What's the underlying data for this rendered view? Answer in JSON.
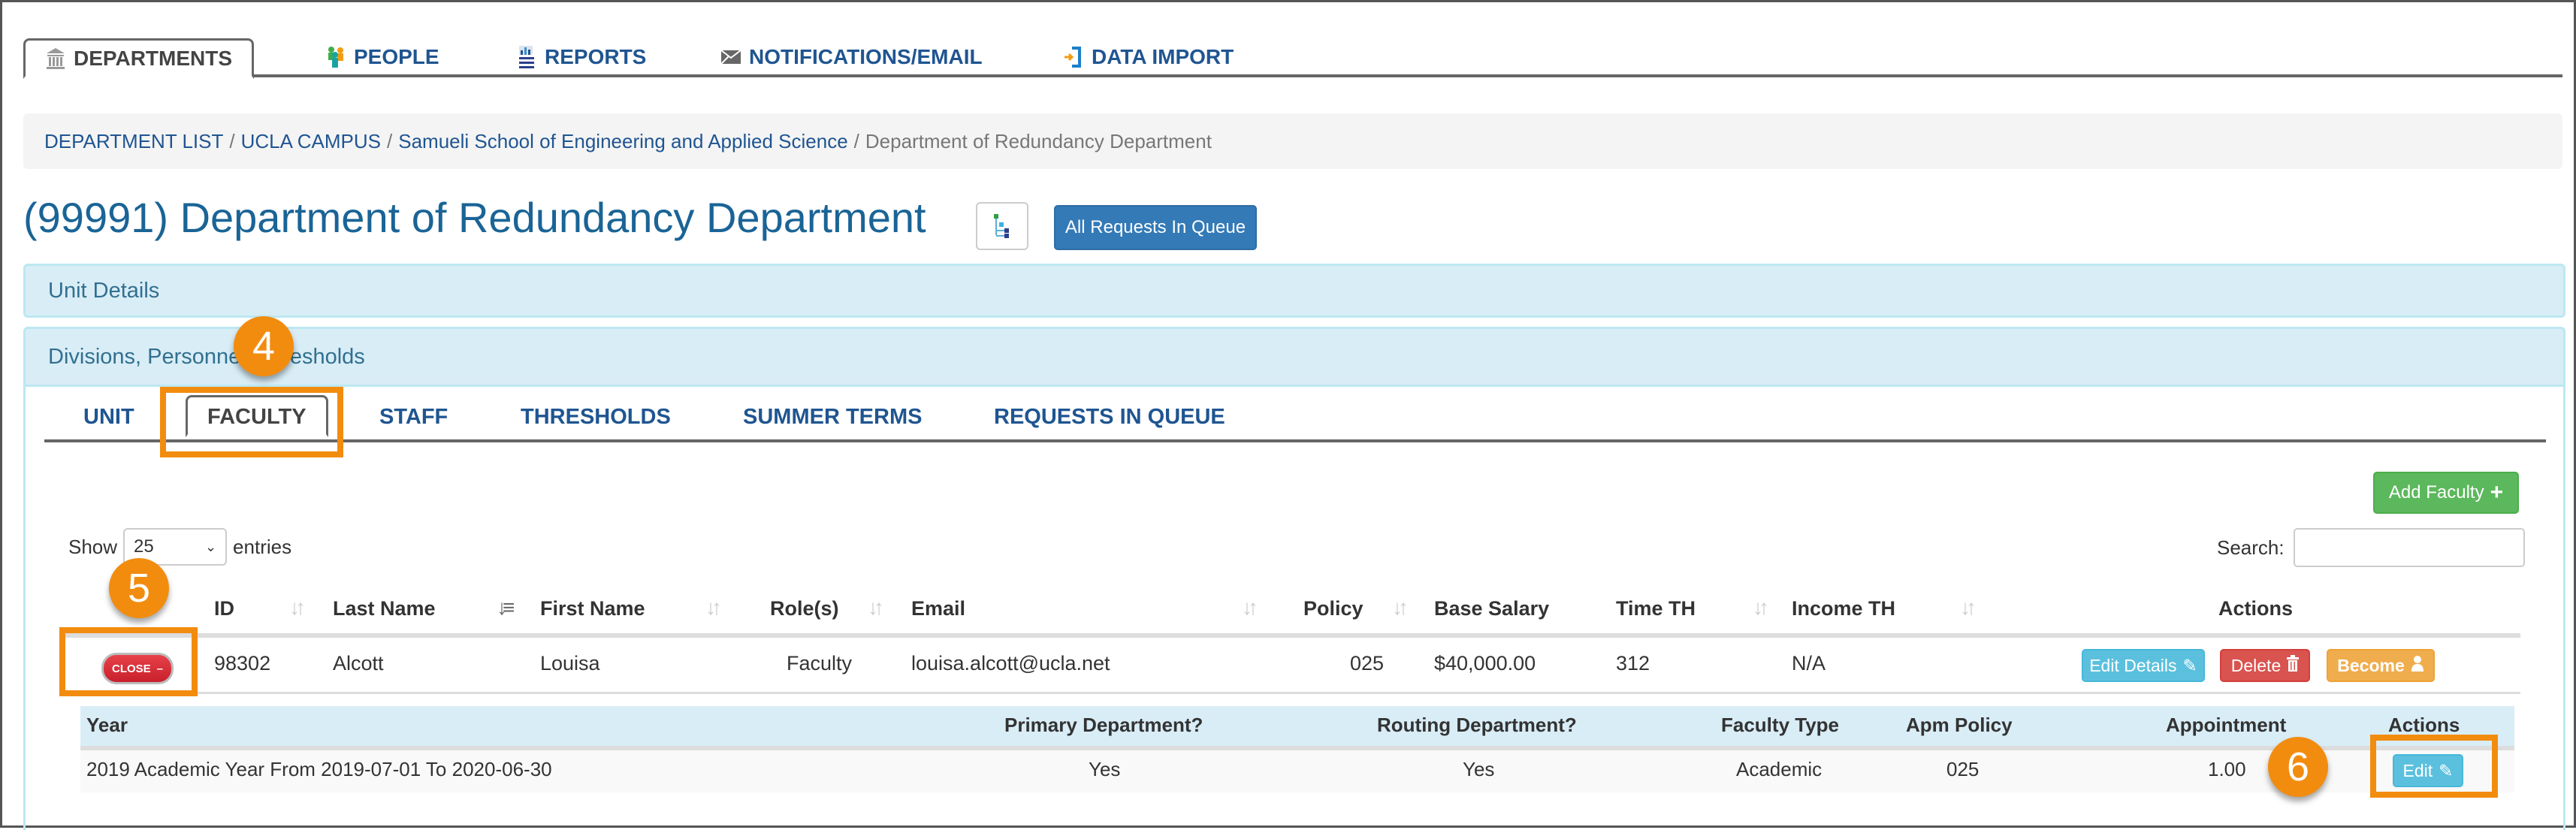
{
  "top_nav": {
    "tabs": [
      {
        "label": "DEPARTMENTS",
        "icon": "building-icon",
        "active": true
      },
      {
        "label": "PEOPLE",
        "icon": "people-icon",
        "active": false
      },
      {
        "label": "REPORTS",
        "icon": "reports-icon",
        "active": false
      },
      {
        "label": "NOTIFICATIONS/EMAIL",
        "icon": "envelope-icon",
        "active": false
      },
      {
        "label": "DATA IMPORT",
        "icon": "import-icon",
        "active": false
      }
    ]
  },
  "breadcrumb": {
    "items": [
      "DEPARTMENT LIST",
      "UCLA CAMPUS",
      "Samueli School of Engineering and Applied Science"
    ],
    "current": "Department of Redundancy Department",
    "separator": "/"
  },
  "page": {
    "title": "(99991) Department of Redundancy Department",
    "tree_icon": "hierarchy-icon",
    "queue_button": "All Requests In Queue"
  },
  "panels": {
    "unit_details": "Unit Details",
    "divisions": "Divisions, Personnel, Thresholds"
  },
  "inner_tabs": [
    {
      "label": "UNIT",
      "active": false
    },
    {
      "label": "FACULTY",
      "active": true
    },
    {
      "label": "STAFF",
      "active": false
    },
    {
      "label": "THRESHOLDS",
      "active": false
    },
    {
      "label": "SUMMER TERMS",
      "active": false
    },
    {
      "label": "REQUESTS IN QUEUE",
      "active": false
    }
  ],
  "faculty": {
    "add_button": "Add Faculty",
    "show_label": "Show",
    "entries_value": "25",
    "entries_label": "entries",
    "search_label": "Search:",
    "search_value": "",
    "columns": [
      "ID",
      "Last Name",
      "First Name",
      "Role(s)",
      "Email",
      "Policy",
      "Base Salary",
      "Time TH",
      "Income TH",
      "Actions"
    ],
    "rows": [
      {
        "toggle": "CLOSE",
        "id": "98302",
        "last_name": "Alcott",
        "first_name": "Louisa",
        "roles": "Faculty",
        "email": "louisa.alcott@ucla.net",
        "policy": "025",
        "base_salary": "$40,000.00",
        "time_th": "312",
        "income_th": "N/A",
        "actions": [
          "Edit Details",
          "Delete",
          "Become"
        ]
      }
    ],
    "detail": {
      "columns": [
        "Year",
        "Primary Department?",
        "Routing Department?",
        "Faculty Type",
        "Apm Policy",
        "Appointment",
        "Actions"
      ],
      "rows": [
        {
          "year": "2019 Academic Year From 2019-07-01 To 2020-06-30",
          "primary": "Yes",
          "routing": "Yes",
          "faculty_type": "Academic",
          "apm_policy": "025",
          "appointment": "1.00",
          "action": "Edit"
        }
      ]
    }
  },
  "annotations": [
    "4",
    "5",
    "6"
  ],
  "colors": {
    "link": "#1f5591",
    "title": "#1a6496",
    "panel": "#d9edf7",
    "annotation": "#f28c0f",
    "primary": "#337ab7",
    "success": "#5cb85c",
    "info": "#5bc0de",
    "danger": "#d9534f",
    "warning": "#f0ad4e"
  }
}
